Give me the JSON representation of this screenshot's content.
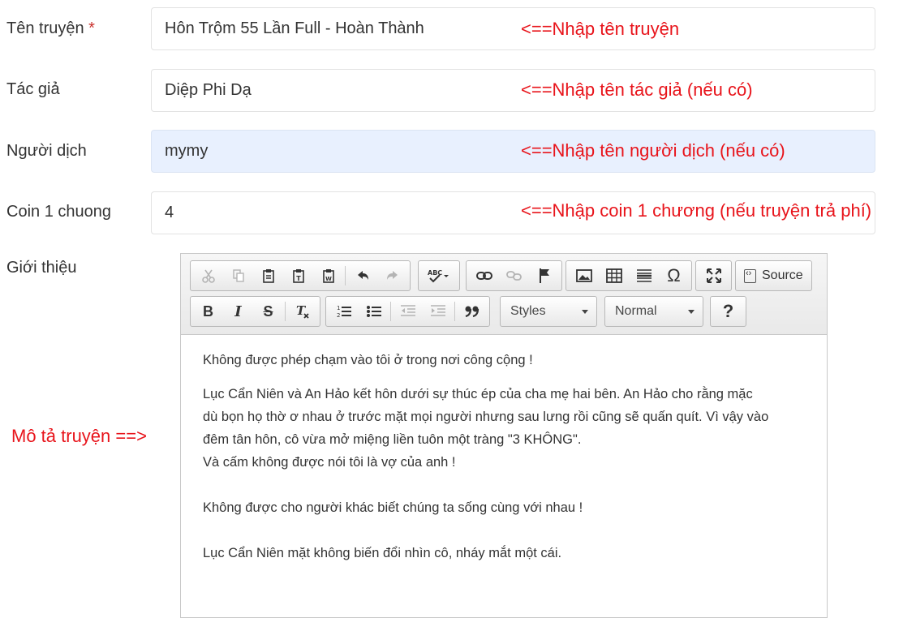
{
  "form": {
    "title": {
      "label": "Tên truyện",
      "required_mark": "*",
      "value": "Hôn Trộm 55 Lần Full - Hoàn Thành",
      "note": "<==Nhập tên truyện"
    },
    "author": {
      "label": "Tác giả",
      "value": "Diệp Phi Dạ",
      "note": "<==Nhập tên tác giả (nếu có)"
    },
    "translator": {
      "label": "Người dịch",
      "value": "mymy",
      "note": "<==Nhập tên người dịch (nếu có)"
    },
    "coin": {
      "label": "Coin 1 chuong",
      "value": "4",
      "note": "<==Nhập coin 1 chương (nếu truyện trả phí)"
    },
    "intro": {
      "label": "Giới thiệu",
      "side_note": "Mô tả truyện ==>"
    }
  },
  "colors": {
    "note": "#e8141b",
    "autofill_bg": "#e8f0fe"
  },
  "editor": {
    "toolbar": {
      "row1": [
        "cut-icon",
        "copy-icon",
        "paste-icon",
        "paste-text-icon",
        "paste-word-icon",
        "undo-icon",
        "redo-icon",
        "spellcheck-icon",
        "link-icon",
        "unlink-icon",
        "anchor-icon",
        "image-icon",
        "table-icon",
        "horizontal-line-icon",
        "special-char-icon",
        "maximize-icon"
      ],
      "source_label": "Source",
      "row2": [
        "bold-icon",
        "italic-icon",
        "strike-icon",
        "remove-format-icon",
        "numbered-list-icon",
        "bulleted-list-icon",
        "outdent-icon",
        "indent-icon",
        "blockquote-icon",
        "help-icon"
      ],
      "bold": "B",
      "italic": "I",
      "strike": "S",
      "help": "?",
      "styles_label": "Styles",
      "format_label": "Normal"
    },
    "content": {
      "p1": "Không được phép chạm vào tôi ở trong nơi công cộng !",
      "p2_line1": "Lục Cẩn Niên và An Hảo kết hôn dưới sự thúc ép của cha mẹ hai bên. An Hảo cho rằng mặc",
      "p2_line2": "dù bọn họ thờ ơ nhau ở trước mặt mọi người nhưng sau lưng rồi cũng sẽ quấn quít. Vì vậy vào",
      "p2_line3": "đêm tân hôn, cô vừa mở miệng liền tuôn một tràng \"3 KHÔNG\".",
      "p2_line4": "Và cấm không được nói tôi là vợ của anh !",
      "p3": "Không được cho người khác biết chúng ta sống cùng với nhau !",
      "p4": "Lục Cẩn Niên mặt không biến đổi nhìn cô, nháy mắt một cái."
    }
  }
}
